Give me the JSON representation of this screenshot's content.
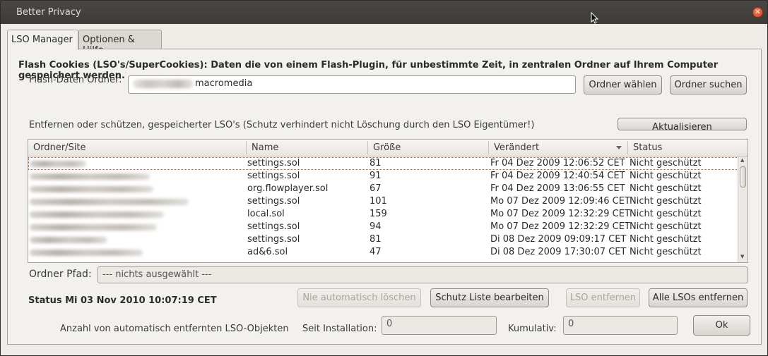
{
  "window": {
    "title": "Better Privacy"
  },
  "tabs": [
    {
      "label": "LSO Manager"
    },
    {
      "label": "Optionen & Hilfe"
    }
  ],
  "heading": "Flash Cookies (LSO's/SuperCookies): Daten die von einem Flash-Plugin, für unbestimmte Zeit, in zentralen Ordner auf Ihrem Computer gespeichert werden.",
  "flash_folder": {
    "label": "Flash-Daten Ordner:",
    "value": "macromedia",
    "choose_button": "Ordner wählen",
    "search_button": "Ordner suchen"
  },
  "remove_label": "Entfernen oder schützen, gespeicherter LSO's (Schutz verhindert nicht Löschung durch den LSO Eigentümer!)",
  "refresh_button": "Aktualisieren",
  "table": {
    "columns": [
      "Ordner/Site",
      "Name",
      "Größe",
      "Verändert",
      "Status"
    ],
    "rows": [
      {
        "name": "settings.sol",
        "size": "81",
        "modified": "Fr 04 Dez 2009 12:06:52 CET",
        "status": "Nicht geschützt"
      },
      {
        "name": "settings.sol",
        "size": "91",
        "modified": "Fr 04 Dez 2009 12:40:54 CET",
        "status": "Nicht geschützt"
      },
      {
        "name": "org.flowplayer.sol",
        "size": "67",
        "modified": "Fr 04 Dez 2009 13:06:55 CET",
        "status": "Nicht geschützt"
      },
      {
        "name": "settings.sol",
        "size": "101",
        "modified": "Mo 07 Dez 2009 12:09:46 CET",
        "status": "Nicht geschützt"
      },
      {
        "name": "local.sol",
        "size": "159",
        "modified": "Mo 07 Dez 2009 12:32:29 CET",
        "status": "Nicht geschützt"
      },
      {
        "name": "settings.sol",
        "size": "94",
        "modified": "Mo 07 Dez 2009 12:32:29 CET",
        "status": "Nicht geschützt"
      },
      {
        "name": "settings.sol",
        "size": "81",
        "modified": "Di 08 Dez 2009 09:09:17 CET",
        "status": "Nicht geschützt"
      },
      {
        "name": "ad&6.sol",
        "size": "47",
        "modified": "Di 08 Dez 2009 17:30:07 CET",
        "status": "Nicht geschützt"
      }
    ]
  },
  "folder_path": {
    "label": "Ordner Pfad:",
    "value": "--- nichts ausgewählt ---"
  },
  "status_text": "Status Mi 03 Nov 2010 10:07:19 CET",
  "buttons": {
    "never_delete": "Nie automatisch löschen",
    "edit_protection": "Schutz Liste bearbeiten",
    "remove_lso": "LSO entfernen",
    "remove_all": "Alle LSOs entfernen",
    "ok": "Ok"
  },
  "counts": {
    "label": "Anzahl von automatisch entfernten LSO-Objekten",
    "since_install_label": "Seit Installation:",
    "since_install_value": "0",
    "cumulative_label": "Kumulativ:",
    "cumulative_value": "0"
  }
}
